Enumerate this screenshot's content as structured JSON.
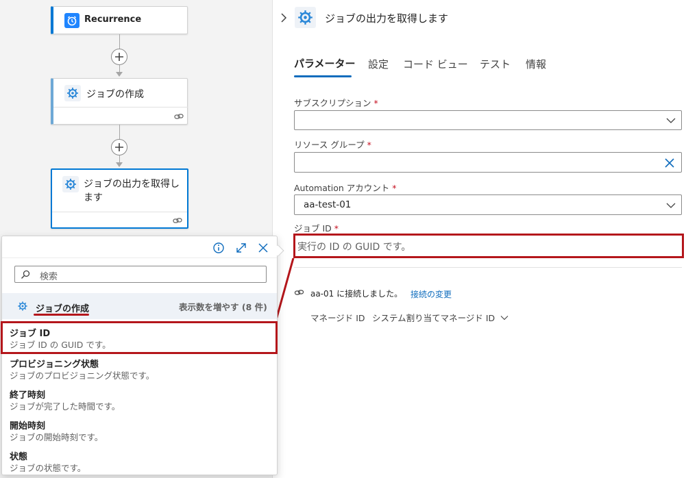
{
  "canvas": {
    "recurrence": {
      "title": "Recurrence"
    },
    "create_job": {
      "title": "ジョブの作成"
    },
    "get_output": {
      "title": "ジョブの出力を取得します"
    }
  },
  "panel": {
    "title": "ジョブの出力を取得します",
    "tabs": [
      "パラメーター",
      "設定",
      "コード ビュー",
      "テスト",
      "情報"
    ],
    "fields": {
      "subscription": {
        "label": "サブスクリプション",
        "value": ""
      },
      "resource_group": {
        "label": "リソース グループ",
        "value": ""
      },
      "automation_account": {
        "label": "Automation アカウント",
        "value": "aa-test-01"
      },
      "job_id": {
        "label": "ジョブ ID",
        "placeholder": "実行の ID の GUID です。"
      }
    },
    "required_mark": "*",
    "connection": {
      "text": "aa-01 に接続しました。",
      "change_link": "接続の変更",
      "managed_id_label": "マネージド ID",
      "managed_id_value": "システム割り当てマネージド ID"
    }
  },
  "popup": {
    "search_placeholder": "検索",
    "group_title": "ジョブの作成",
    "show_more": "表示数を増やす (8 件)",
    "items": [
      {
        "title": "ジョブ ID",
        "desc": "ジョブ ID の GUID です。"
      },
      {
        "title": "プロビジョニング状態",
        "desc": "ジョブのプロビジョニング状態です。"
      },
      {
        "title": "終了時刻",
        "desc": "ジョブが完了した時間です。"
      },
      {
        "title": "開始時刻",
        "desc": "ジョブの開始時刻です。"
      },
      {
        "title": "状態",
        "desc": "ジョブの状態です。"
      }
    ]
  },
  "colors": {
    "accent": "#0f6cbd",
    "highlight": "#b4161b",
    "selected_bar": "#0078d4",
    "icon_blue": "#2b88d8"
  },
  "icons": {
    "recurrence": "alarm-clock-icon",
    "automation": "automation-gear-icon",
    "link": "link-icon"
  }
}
